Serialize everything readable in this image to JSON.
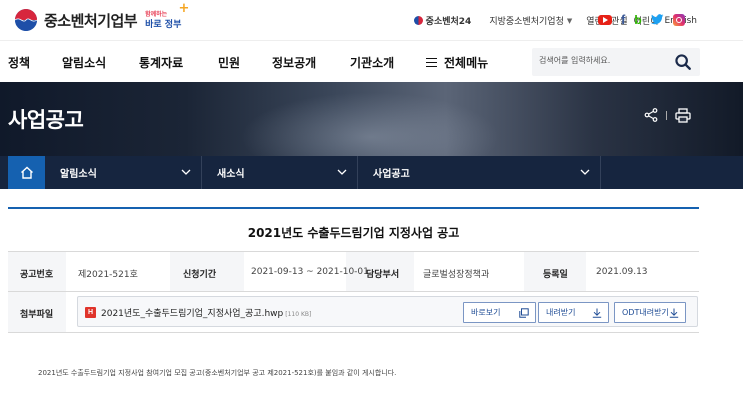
{
  "header": {
    "logo_text": "중소벤처기업부",
    "slogan_small": "함께하는",
    "slogan_main": "바로 정부",
    "sme24": "중소벤처24",
    "regional": "지방중소벤처기업청",
    "utility_links": [
      "열린장관실",
      "어린이",
      "English"
    ],
    "sns": [
      "youtube-icon",
      "facebook-icon",
      "blog-icon",
      "twitter-icon",
      "instagram-icon"
    ]
  },
  "gnb": {
    "items": [
      "정책",
      "알림소식",
      "통계자료",
      "민원",
      "정보공개",
      "기관소개"
    ],
    "all_menu": "전체메뉴",
    "search_placeholder": "검색어를 입력하세요."
  },
  "banner": {
    "title": "사업공고"
  },
  "location": {
    "items": [
      "알림소식",
      "새소식",
      "사업공고"
    ]
  },
  "notice": {
    "title": "2021년도 수출두드림기업 지정사업 공고",
    "fields": {
      "no_label": "공고번호",
      "no_value": "제2021-521호",
      "period_label": "신청기간",
      "period_value": "2021-09-13 ~ 2021-10-01",
      "dept_label": "담당부서",
      "dept_value": "글로벌성장정책과",
      "date_label": "등록일",
      "date_value": "2021.09.13",
      "attach_label": "첨부파일"
    },
    "attachment": {
      "type_badge": "H",
      "name": "2021년도_수출두드림기업_지정사업_공고.hwp",
      "size": "[110 KB]",
      "view": "바로보기",
      "download": "내려받기",
      "odt": "ODT내려받기"
    },
    "description": "2021년도 수출두드림기업 지정사업 참여기업 모집 공고(중소벤처기업부 공고 제2021-521호)를 붙임과 같이 게시합니다."
  },
  "colors": {
    "primary_blue": "#1561b0",
    "nav_dark": "#16253f",
    "button_text": "#1f4c95"
  }
}
